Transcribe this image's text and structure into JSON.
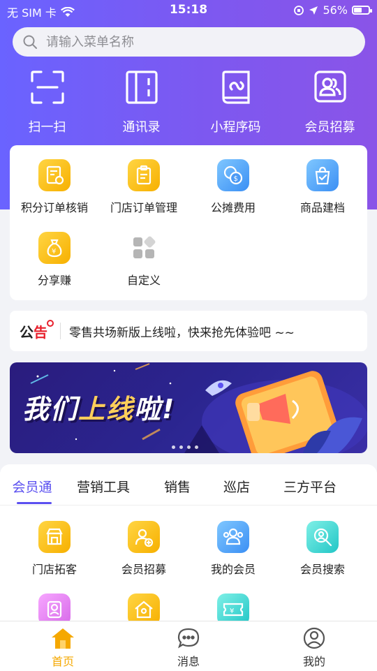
{
  "status_bar": {
    "carrier": "无 SIM 卡",
    "time": "15:18",
    "battery_pct": "56%",
    "battery_level": 0.56
  },
  "search": {
    "placeholder": "请输入菜单名称"
  },
  "top_nav": [
    {
      "label": "扫一扫",
      "icon": "scan-icon"
    },
    {
      "label": "通讯录",
      "icon": "contacts-book-icon"
    },
    {
      "label": "小程序码",
      "icon": "mini-program-icon"
    },
    {
      "label": "会员招募",
      "icon": "member-recruit-icon"
    }
  ],
  "quick_menu": [
    {
      "label": "积分订单核销",
      "icon": "points-order-icon",
      "color": "#f9bd1b"
    },
    {
      "label": "门店订单管理",
      "icon": "clipboard-icon",
      "color": "#f9bd1b"
    },
    {
      "label": "公摊费用",
      "icon": "coins-icon",
      "color": "#3b8ff4"
    },
    {
      "label": "商品建档",
      "icon": "shopping-bag-icon",
      "color": "#3b8ff4"
    },
    {
      "label": "分享赚",
      "icon": "money-bag-icon",
      "color": "#f9bd1b"
    },
    {
      "label": "自定义",
      "icon": "custom-grid-icon",
      "color": "#aaaaaa"
    }
  ],
  "notice": {
    "tag_prefix": "公",
    "tag_highlight": "告",
    "text": "零售共场新版上线啦，快来抢先体验吧 ~~"
  },
  "banner": {
    "title_part1": "我们",
    "title_highlight": "上线",
    "title_part2": "啦!",
    "slide_count": 4
  },
  "tabs": {
    "items": [
      "会员通",
      "营销工具",
      "销售",
      "巡店",
      "三方平台"
    ],
    "active": "会员通"
  },
  "member_tools": [
    {
      "label": "门店拓客",
      "icon": "store-icon",
      "color": "#f9bd1b"
    },
    {
      "label": "会员招募",
      "icon": "add-member-icon",
      "color": "#f9bd1b"
    },
    {
      "label": "我的会员",
      "icon": "members-group-icon",
      "color": "#3b8ff4"
    },
    {
      "label": "会员搜索",
      "icon": "member-search-icon",
      "color": "#22c6c6"
    },
    {
      "label": "",
      "icon": "member-card-icon",
      "color": "#d76ae9"
    },
    {
      "label": "",
      "icon": "home-member-icon",
      "color": "#f9bd1b"
    },
    {
      "label": "",
      "icon": "coupon-icon",
      "color": "#22c6c6"
    }
  ],
  "tab_bar": [
    {
      "label": "首页",
      "icon": "home-icon",
      "active": true
    },
    {
      "label": "消息",
      "icon": "message-icon",
      "active": false
    },
    {
      "label": "我的",
      "icon": "profile-icon",
      "active": false
    }
  ]
}
